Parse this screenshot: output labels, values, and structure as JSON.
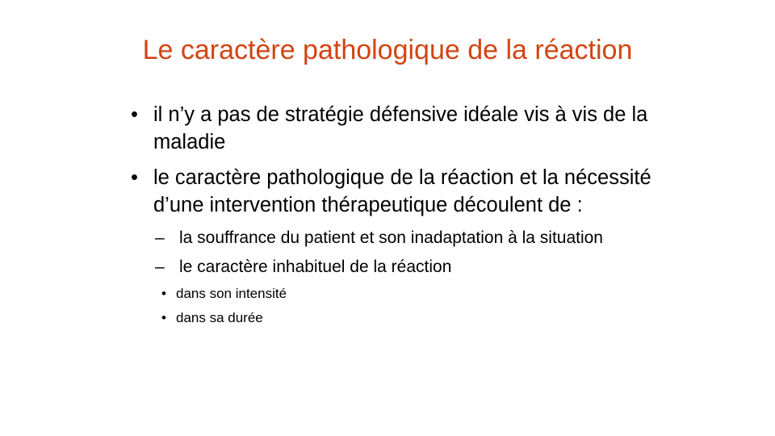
{
  "slide": {
    "title": "Le caractère pathologique de la réaction",
    "title_color": "#d24513",
    "bullet_symbol": "•",
    "dash_symbol": "–",
    "bullets": [
      {
        "text": "il n’y a pas de stratégie défensive idéale vis à vis de la maladie"
      },
      {
        "text": "le caractère pathologique de la réaction et la nécessité d’une intervention thérapeutique découlent de :",
        "sub": [
          {
            "text": "la souffrance du patient et son inadaptation à la situation"
          },
          {
            "text": "le caractère inhabituel de la réaction",
            "sub": [
              {
                "text": "dans son intensité"
              },
              {
                "text": "dans sa durée"
              }
            ]
          }
        ]
      }
    ]
  }
}
